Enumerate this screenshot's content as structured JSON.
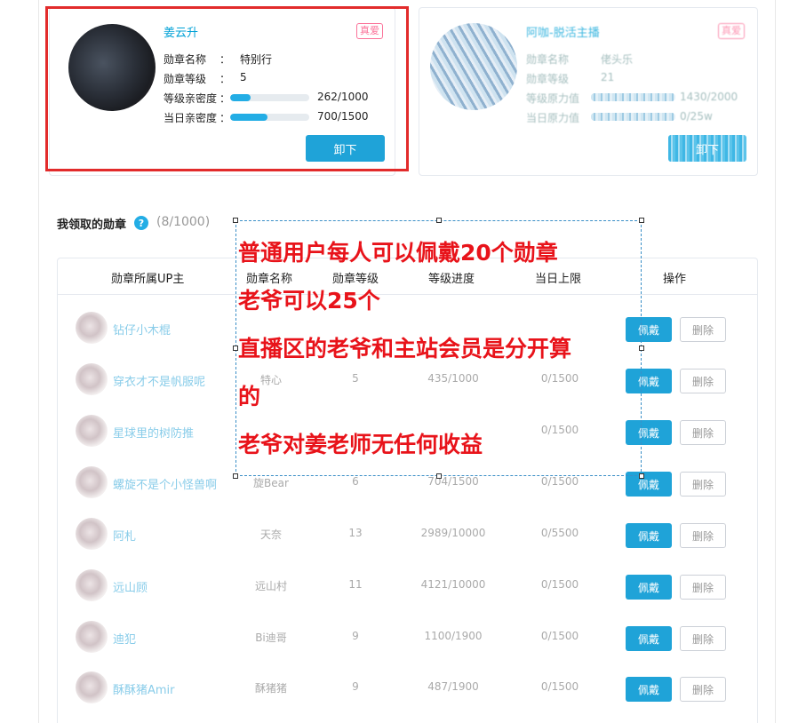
{
  "active_card": {
    "name": "姜云升",
    "tag": "真爱",
    "medal_name_label": "勋章名称",
    "medal_name": "特别行",
    "medal_level_label": "勋章等级",
    "medal_level": "5",
    "level_intimacy_label": "等级亲密度",
    "level_intimacy_value": "262/1000",
    "level_intimacy_ratio": 0.262,
    "daily_intimacy_label": "当日亲密度",
    "daily_intimacy_value": "700/1500",
    "daily_intimacy_ratio": 0.467,
    "colon": "：",
    "unload_label": "卸下"
  },
  "other_card": {
    "name": "阿咖-脱活主播",
    "tag": "真爱",
    "medal_name_label": "勋章名称",
    "medal_name": "佬头乐",
    "medal_level_label": "勋章等级",
    "medal_level": "21",
    "level_power_label": "等级原力值",
    "level_power_value": "1430/2000",
    "daily_power_label": "当日原力值",
    "daily_power_value": "0/25w",
    "unload_label": "卸下"
  },
  "section": {
    "title": "我领取的勋章",
    "help_icon": "?",
    "count": "(8/1000)"
  },
  "table": {
    "headers": [
      "勋章所属UP主",
      "勋章名称",
      "勋章等级",
      "等级进度",
      "当日上限",
      "操作"
    ],
    "wear_label": "佩戴",
    "delete_label": "删除",
    "rows": [
      {
        "up": "钻仔小木棍",
        "medal": "",
        "level": "",
        "progress": "",
        "limit": ""
      },
      {
        "up": "穿衣才不是帆服呢",
        "medal": "特心",
        "level": "5",
        "progress": "435/1000",
        "limit": "0/1500"
      },
      {
        "up": "星球里的树防推",
        "medal": "",
        "level": "",
        "progress": "",
        "limit": "0/1500"
      },
      {
        "up": "螺旋不是个小怪兽啊",
        "medal": "旋Bear",
        "level": "6",
        "progress": "704/1500",
        "limit": "0/1500"
      },
      {
        "up": "阿札",
        "medal": "天奈",
        "level": "13",
        "progress": "2989/10000",
        "limit": "0/5500"
      },
      {
        "up": "远山顾",
        "medal": "远山村",
        "level": "11",
        "progress": "4121/10000",
        "limit": "0/1500"
      },
      {
        "up": "迪犯",
        "medal": "Bi迪哥",
        "level": "9",
        "progress": "1100/1900",
        "limit": "0/1500"
      },
      {
        "up": "酥酥猪Amir",
        "medal": "酥猪猪",
        "level": "9",
        "progress": "487/1900",
        "limit": "0/1500"
      }
    ]
  },
  "annotation": {
    "lines": [
      "普通用户每人可以佩戴20个勋章",
      "老爷可以25个",
      "直播区的老爷和主站会员是分开算",
      "的",
      "老爷对姜老师无任何收益"
    ]
  },
  "colors": {
    "accent": "#1fa3d8",
    "highlight_red": "#e22b2b",
    "annotation_red": "#e8131a",
    "tag_pink": "#fb7299"
  }
}
